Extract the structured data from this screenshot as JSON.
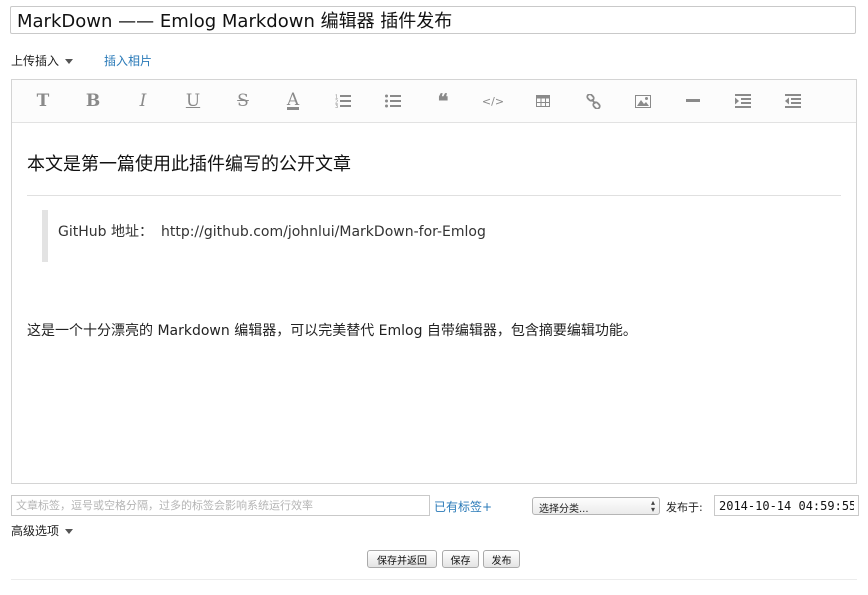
{
  "title": {
    "value": "MarkDown —— Emlog Markdown 编辑器 插件发布"
  },
  "upload": {
    "insert_label": "上传插入",
    "insert_photo_link": "插入相片"
  },
  "toolbar": {
    "buttons": [
      {
        "name": "title-icon",
        "glyph": "T"
      },
      {
        "name": "bold-icon",
        "glyph": "B"
      },
      {
        "name": "italic-icon",
        "glyph": "I"
      },
      {
        "name": "underline-icon",
        "glyph": "U"
      },
      {
        "name": "strikethrough-icon",
        "glyph": "S"
      },
      {
        "name": "font-color-icon",
        "glyph": "A"
      },
      {
        "name": "ordered-list-icon",
        "glyph": ""
      },
      {
        "name": "unordered-list-icon",
        "glyph": ""
      },
      {
        "name": "quote-icon",
        "glyph": "❝"
      },
      {
        "name": "code-icon",
        "glyph": "</>"
      },
      {
        "name": "table-icon",
        "glyph": ""
      },
      {
        "name": "link-icon",
        "glyph": ""
      },
      {
        "name": "image-icon",
        "glyph": ""
      },
      {
        "name": "horizontal-rule-icon",
        "glyph": ""
      },
      {
        "name": "indent-icon",
        "glyph": ""
      },
      {
        "name": "outdent-icon",
        "glyph": ""
      }
    ]
  },
  "content": {
    "heading": "本文是第一篇使用此插件编写的公开文章",
    "quote_label": "GitHub 地址：",
    "quote_url": "http://github.com/johnlui/MarkDown-for-Emlog",
    "paragraph": "这是一个十分漂亮的 Markdown 编辑器，可以完美替代 Emlog 自带编辑器，包含摘要编辑功能。"
  },
  "meta": {
    "tags_placeholder": "文章标签，逗号或空格分隔，过多的标签会影响系统运行效率",
    "existing_tags": "已有标签+",
    "category": "选择分类...",
    "publish_at_label": "发布于:",
    "publish_at": "2014-10-14 04:59:55",
    "advanced": "高级选项"
  },
  "actions": {
    "save_return": "保存并返回",
    "save": "保存",
    "publish": "发布"
  },
  "colors": {
    "link": "#2a7ab8",
    "icon": "#8a8a8a",
    "border": "#d4d4d4"
  }
}
